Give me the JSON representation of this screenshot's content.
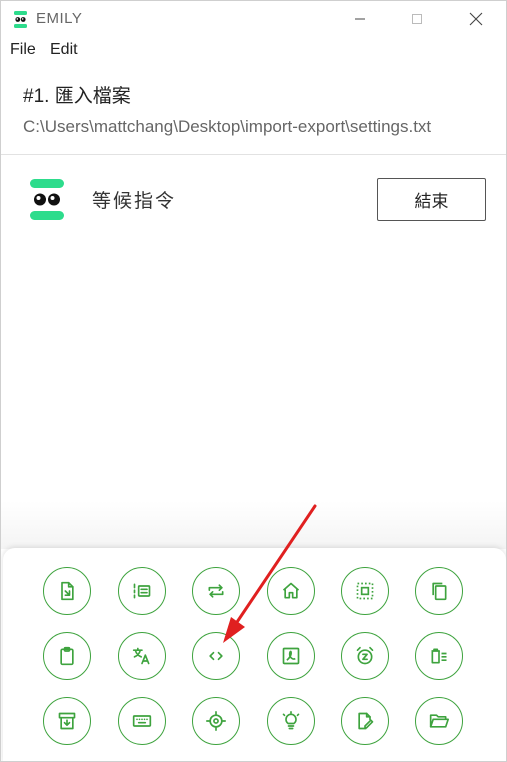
{
  "window": {
    "title": "EMILY",
    "min_label": "—",
    "max_label": "☐",
    "close_label": "✕"
  },
  "menu": {
    "file": "File",
    "edit": "Edit"
  },
  "task": {
    "title": "#1. 匯入檔案",
    "path": "C:\\Users\\mattchang\\Desktop\\import-export\\settings.txt"
  },
  "status": {
    "text": "等候指令",
    "end_button": "結束"
  },
  "colors": {
    "accent": "#3ea33e",
    "logo": "#2ddc8c",
    "annotation_arrow": "#e02020"
  },
  "tools": [
    [
      "import-file-icon",
      "numbered-list-icon",
      "repeat-icon",
      "home-icon",
      "select-all-icon",
      "copy-icon"
    ],
    [
      "clipboard-icon",
      "translate-icon",
      "code-icon",
      "pdf-icon",
      "alarm-snooze-icon",
      "clear-list-icon"
    ],
    [
      "archive-icon",
      "keyboard-icon",
      "target-icon",
      "lightbulb-icon",
      "edit-file-icon",
      "open-folder-icon"
    ]
  ]
}
